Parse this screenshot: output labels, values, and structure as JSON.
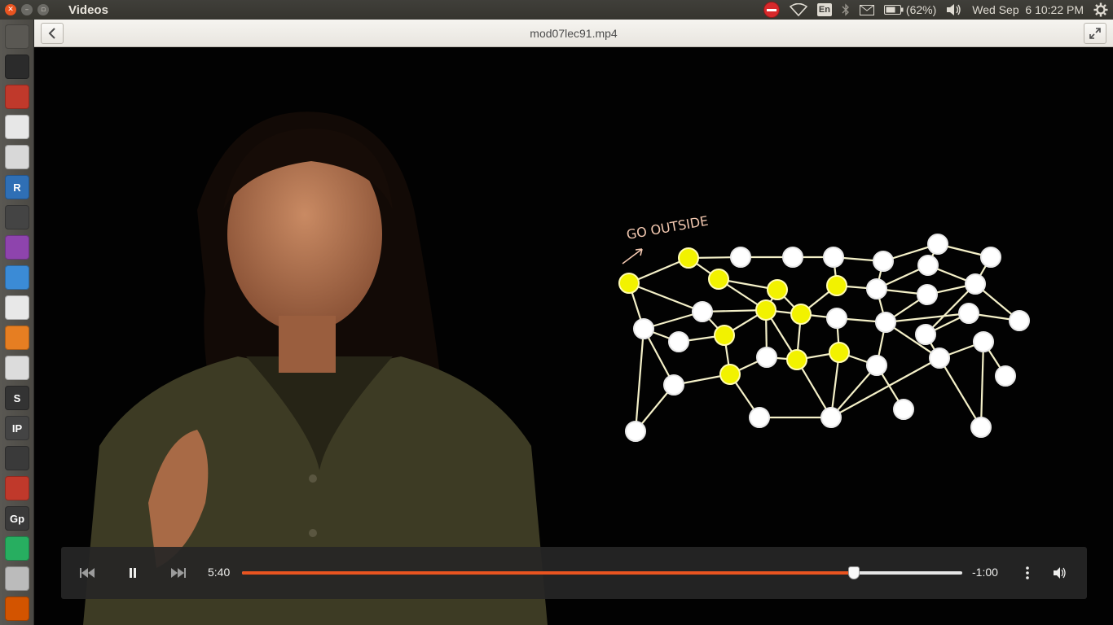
{
  "window": {
    "app_title": "Videos",
    "file_title": "mod07lec91.mp4"
  },
  "panel": {
    "keyboard_layout": "En",
    "battery": "(62%)",
    "clock": "Wed Sep  6 10:22 PM"
  },
  "launcher": {
    "items": [
      {
        "name": "dash-home",
        "glyph": ""
      },
      {
        "name": "terminal",
        "glyph": ""
      },
      {
        "name": "files",
        "glyph": ""
      },
      {
        "name": "chrome",
        "glyph": ""
      },
      {
        "name": "document-viewer",
        "glyph": ""
      },
      {
        "name": "r-studio",
        "glyph": "R"
      },
      {
        "name": "video-editor",
        "glyph": ""
      },
      {
        "name": "screen-recorder",
        "glyph": ""
      },
      {
        "name": "writer",
        "glyph": ""
      },
      {
        "name": "gmail",
        "glyph": ""
      },
      {
        "name": "impress",
        "glyph": ""
      },
      {
        "name": "text-editor",
        "glyph": ""
      },
      {
        "name": "sublime-text",
        "glyph": "S"
      },
      {
        "name": "ipython",
        "glyph": "IP"
      },
      {
        "name": "network-tool",
        "glyph": ""
      },
      {
        "name": "opera",
        "glyph": ""
      },
      {
        "name": "gephi",
        "glyph": "Gp"
      },
      {
        "name": "calc",
        "glyph": ""
      },
      {
        "name": "drive",
        "glyph": ""
      },
      {
        "name": "stack",
        "glyph": ""
      },
      {
        "name": "archive",
        "glyph": ""
      }
    ]
  },
  "video": {
    "annotation": "GO OUTSIDE",
    "colors": {
      "highlight_node": "#f2f200",
      "plain_node": "#ffffff",
      "edge": "#f4f0c8"
    }
  },
  "controls": {
    "elapsed": "5:40",
    "remaining": "-1:00",
    "progress": 0.85,
    "accent": "#e95420"
  }
}
